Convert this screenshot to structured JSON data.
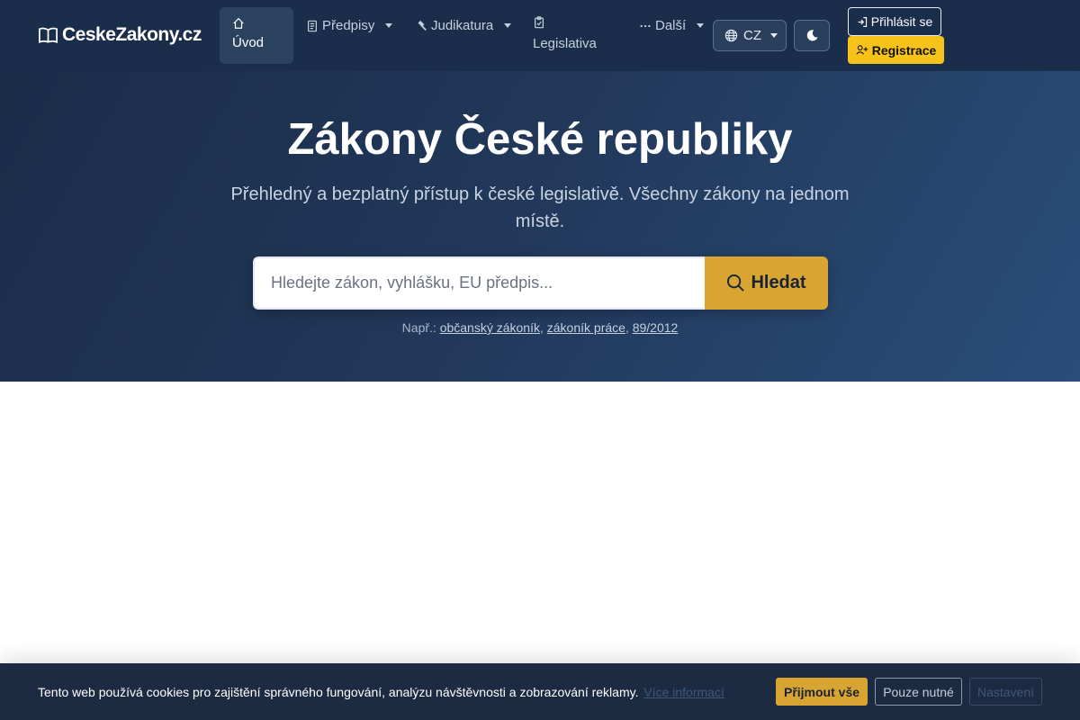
{
  "navbar": {
    "brand": "CeskeZakony.cz",
    "items": [
      {
        "label": "Úvod",
        "icon": "home-icon",
        "active": true
      },
      {
        "label": "Předpisy",
        "icon": "document-icon",
        "dropdown": true
      },
      {
        "label": "Judikatura",
        "icon": "hammer-icon",
        "dropdown": true
      },
      {
        "label": "Legislativa",
        "icon": "clipboard-icon"
      },
      {
        "label": "Další",
        "icon": "dots-icon",
        "dropdown": true
      }
    ],
    "language": "CZ",
    "login_label": "Přihlásit se",
    "register_label": "Registrace"
  },
  "hero": {
    "title": "Zákony České republiky",
    "subtitle": "Přehledný a bezplatný přístup k české legislativě. Všechny zákony na jednom místě.",
    "search_placeholder": "Hledejte zákon, vyhlášku, EU předpis...",
    "search_button": "Hledat",
    "examples_prefix": "Např.:",
    "examples": [
      "občanský zákoník",
      "zákoník práce",
      "89/2012"
    ]
  },
  "cookie": {
    "text": "Tento web používá cookies pro zajištění správného fungování, analýzu návštěvnosti a zobrazování reklamy.",
    "more_info": "Více informací",
    "accept_all": "Přijmout vše",
    "necessary_only": "Pouze nutné",
    "settings": "Nastavení"
  },
  "colors": {
    "navbar_bg": "#1a2e4c",
    "accent_yellow": "#f7c31b",
    "search_button": "#d9a532",
    "cookie_bg": "#1c2b42"
  }
}
